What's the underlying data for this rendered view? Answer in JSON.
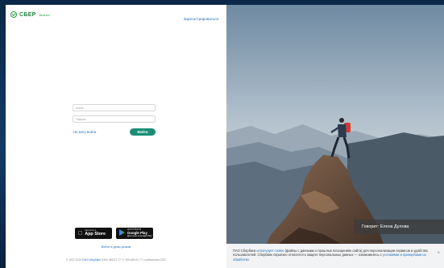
{
  "brand": {
    "name": "СБЕР",
    "suffix": "Бизнес"
  },
  "header": {
    "register_link": "Зарегистрироваться"
  },
  "login_form": {
    "login_placeholder": "Логин",
    "password_placeholder": "Пароль",
    "forgot_link": "Не могу войти",
    "submit_label": "Войти"
  },
  "stores": {
    "apple": {
      "small": "Загрузите в",
      "big": "App Store"
    },
    "google": {
      "small": "ДОСТУПНО В",
      "big": "Google Play",
      "sub": "Доступно в Google Play"
    }
  },
  "demo_link": "Войти в демо-режим",
  "footer": {
    "copyright": "© 1997-2019",
    "company_link": "ПАО Сбербанк",
    "phones": "8 800 555-57-77  +7 495 665-57-77  с мобильных 0321"
  },
  "photo": {
    "caption": "Говорит: Елена Дулова"
  },
  "cookie_notice": {
    "prefix": "ПАО Сбербанк",
    "link1": "использует cookie",
    "middle": "(файлы с данными о прошлых посещениях сайта) для персонализации сервисов и удобства пользователей. Сбербанк серьёзно относится к защите персональных данных — ознакомьтесь с",
    "link2": "условиями и принципами их обработки.",
    "close_symbol": "×"
  },
  "colors": {
    "brand_green": "#21a038",
    "button_teal": "#1b8f73",
    "link_blue": "#1f6fbf"
  }
}
